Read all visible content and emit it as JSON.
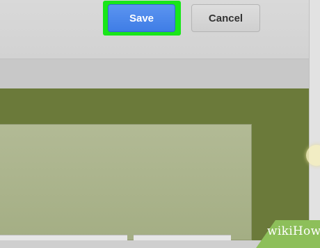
{
  "toolbar": {
    "save_label": "Save",
    "cancel_label": "Cancel",
    "highlight_color": "#19e619",
    "save_color": "#4a89ea"
  },
  "canvas": {
    "background_color": "#6b7a3a"
  },
  "watermark": {
    "text": "wikiHow"
  }
}
